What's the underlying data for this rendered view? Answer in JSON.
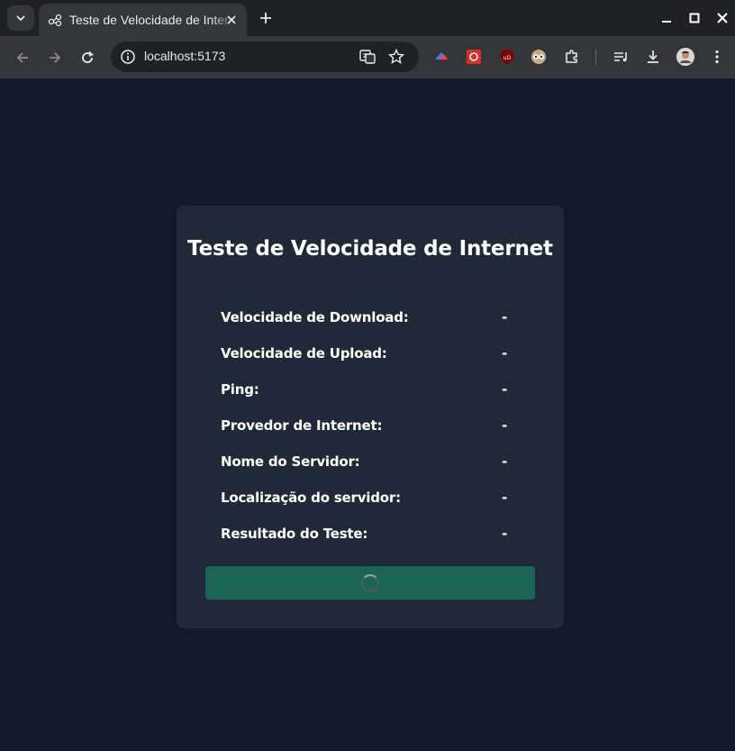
{
  "browser": {
    "tab_title": "Teste de Velocidade de Internet",
    "url": "localhost:5173"
  },
  "card": {
    "title": "Teste de Velocidade de Internet",
    "rows": [
      {
        "label": "Velocidade de Download:",
        "value": "-"
      },
      {
        "label": "Velocidade de Upload:",
        "value": "-"
      },
      {
        "label": "Ping:",
        "value": "-"
      },
      {
        "label": "Provedor de Internet:",
        "value": "-"
      },
      {
        "label": "Nome do Servidor:",
        "value": "-"
      },
      {
        "label": "Localização do servidor:",
        "value": "-"
      },
      {
        "label": "Resultado do Teste:",
        "value": "-"
      }
    ],
    "button_state": "loading"
  },
  "colors": {
    "page_bg": "#111827",
    "card_bg": "#1f2937",
    "button_bg": "#1c6455",
    "text": "#ffffff"
  }
}
